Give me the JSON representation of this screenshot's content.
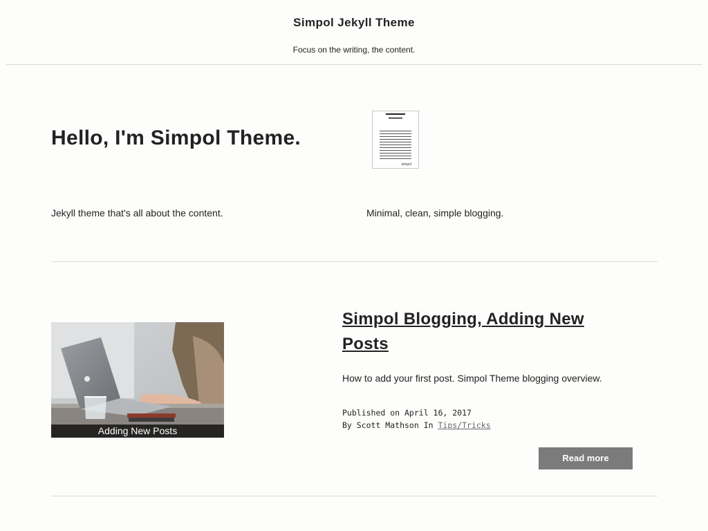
{
  "header": {
    "title": "Simpol Jekyll Theme",
    "tagline": "Focus on the writing, the content."
  },
  "hero": {
    "title": "Hello, I'm Simpol Theme.",
    "desc_left": "Jekyll theme that's all about the content.",
    "desc_right": "Minimal, clean, simple blogging.",
    "icon_name": "document-icon",
    "icon_label": "simpol"
  },
  "post": {
    "thumbnail_caption": "Adding New Posts",
    "thumbnail_icon": "laptop-photo",
    "title": "Simpol Blogging, Adding New Posts",
    "excerpt": "How to add your first post. Simpol Theme blogging overview.",
    "published": "Published on April 16, 2017",
    "author_prefix": "By Scott Mathson In",
    "category": "Tips/Tricks",
    "read_more_label": "Read more"
  },
  "colors": {
    "background": "#fdfdfb",
    "text": "#222222",
    "button": "#7b7b7b",
    "rule": "#d8d8d8"
  }
}
